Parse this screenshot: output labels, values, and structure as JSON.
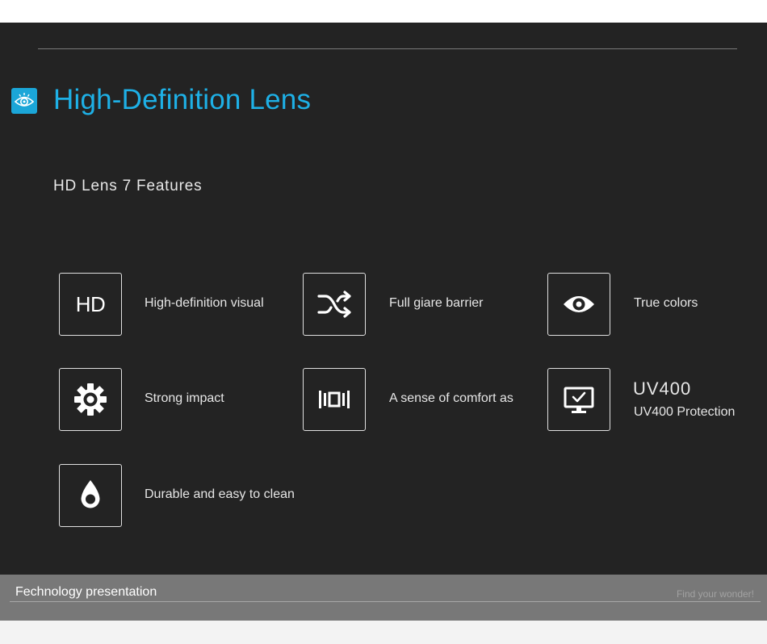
{
  "header": {
    "title": "High-Definition Lens",
    "icon": "eye-icon",
    "accent_color": "#1eb0e6"
  },
  "subtitle": "HD Lens 7 Features",
  "features": [
    {
      "icon": "hd-icon",
      "icon_text": "HD",
      "label": "High-definition visual"
    },
    {
      "icon": "shuffle-icon",
      "label": "Full giare barrier"
    },
    {
      "icon": "eye-icon",
      "label": "True colors"
    },
    {
      "icon": "gear-icon",
      "label": "Strong impact"
    },
    {
      "icon": "lens-bracket-icon",
      "label": "A sense of comfort as"
    },
    {
      "icon": "monitor-check-icon",
      "title": "UV400",
      "label": "UV400 Protection"
    },
    {
      "icon": "water-drop-icon",
      "label": "Durable and easy to clean"
    }
  ],
  "footer": {
    "left": "Fechnology presentation",
    "right": "Find your wonder!"
  }
}
